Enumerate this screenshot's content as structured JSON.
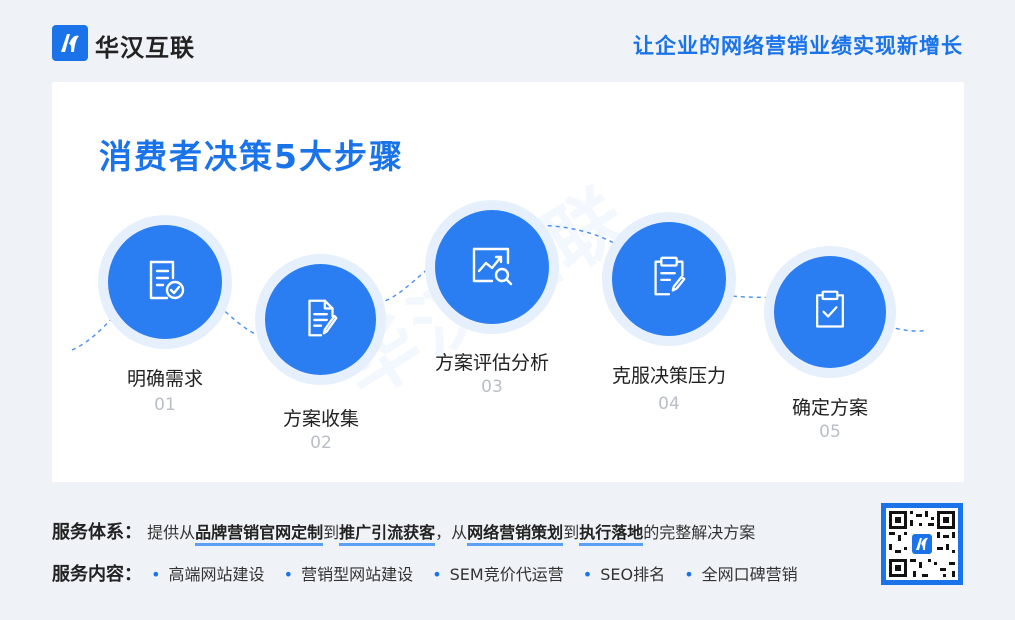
{
  "header": {
    "brand": "华汉互联",
    "slogan": "让企业的网络营销业绩实现新增长"
  },
  "card": {
    "title": "消费者决策5大步骤",
    "watermark": "华汉互联"
  },
  "steps": [
    {
      "label": "明确需求",
      "num": "01",
      "icon": "document-check-icon"
    },
    {
      "label": "方案收集",
      "num": "02",
      "icon": "document-edit-icon"
    },
    {
      "label": "方案评估分析",
      "num": "03",
      "icon": "chart-analysis-icon"
    },
    {
      "label": "克服决策压力",
      "num": "04",
      "icon": "clipboard-edit-icon"
    },
    {
      "label": "确定方案",
      "num": "05",
      "icon": "clipboard-check-icon"
    }
  ],
  "footer": {
    "system_key": "服务体系：",
    "system_text_1": "提供从",
    "system_hl_1": "品牌营销官网定制",
    "system_text_2": "到",
    "system_hl_2": "推广引流获客",
    "system_text_3": "，从",
    "system_hl_3": "网络营销策划",
    "system_text_4": "到",
    "system_hl_4": "执行落地",
    "system_text_5": "的完整解决方案",
    "content_key": "服务内容：",
    "services": [
      "高端网站建设",
      "营销型网站建设",
      "SEM竞价代运营",
      "SEO排名",
      "全网口碑营销"
    ]
  },
  "colors": {
    "accent": "#1a73e8",
    "disc": "#2b7ef2",
    "halo": "#e6f0fc",
    "number": "#b9bec7"
  }
}
